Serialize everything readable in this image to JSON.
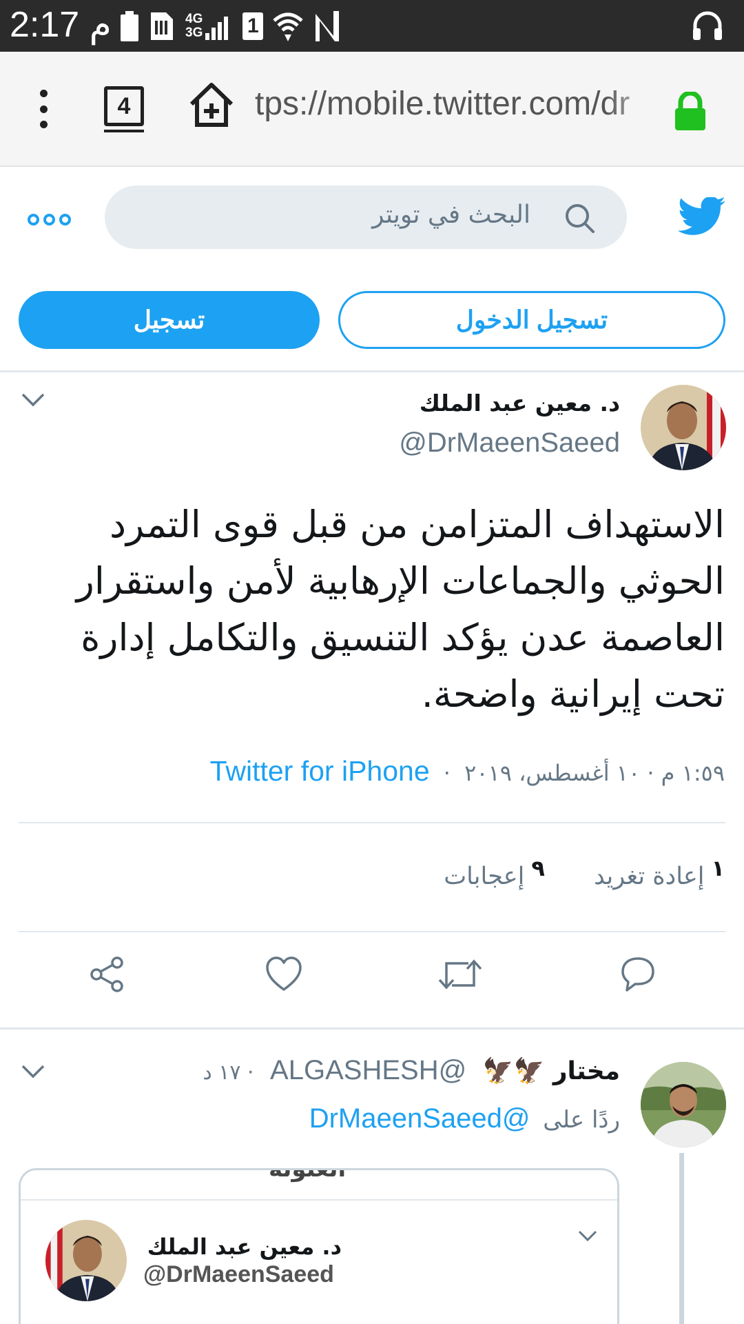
{
  "status_bar": {
    "time": "2:17 م",
    "network_label_top": "4G",
    "network_label_bottom": "3G",
    "sim_slot": "1"
  },
  "browser": {
    "tab_count": "4",
    "url": "tps://mobile.twitter.com/dr"
  },
  "header": {
    "search_placeholder": "البحث في تويتر",
    "signup_label": "تسجيل",
    "login_label": "تسجيل الدخول"
  },
  "tweet": {
    "author_name": "د. معين عبد الملك",
    "author_handle": "@DrMaeenSaeed",
    "text": "الاستهداف المتزامن من قبل قوى التمرد الحوثي والجماعات الإرهابية لأمن واستقرار العاصمة عدن يؤكد التنسيق والتكامل إدارة تحت إيرانية واضحة.",
    "timestamp": "١:٥٩ م · ١٠ أغسطس، ٢٠١٩",
    "separator": "·",
    "source": "Twitter for iPhone",
    "retweet_count": "١",
    "retweet_label": "إعادة تغريد",
    "like_count": "٩",
    "like_label": "إعجابات"
  },
  "reply": {
    "author_name": "مختار 🦅🦅",
    "author_handle": "@ALGASHESH",
    "time": "· ١٧ د",
    "replying_to_label": "ردًا على",
    "replying_to_handle": "@DrMaeenSaeed",
    "quoted": {
      "cut_text": "العنونة",
      "author_name": "د. معين عبد الملك",
      "author_handle": "@DrMaeenSaeed"
    }
  },
  "colors": {
    "twitter_blue": "#1da1f2",
    "secondary_text": "#657786",
    "lock_green": "#1fc01f"
  }
}
